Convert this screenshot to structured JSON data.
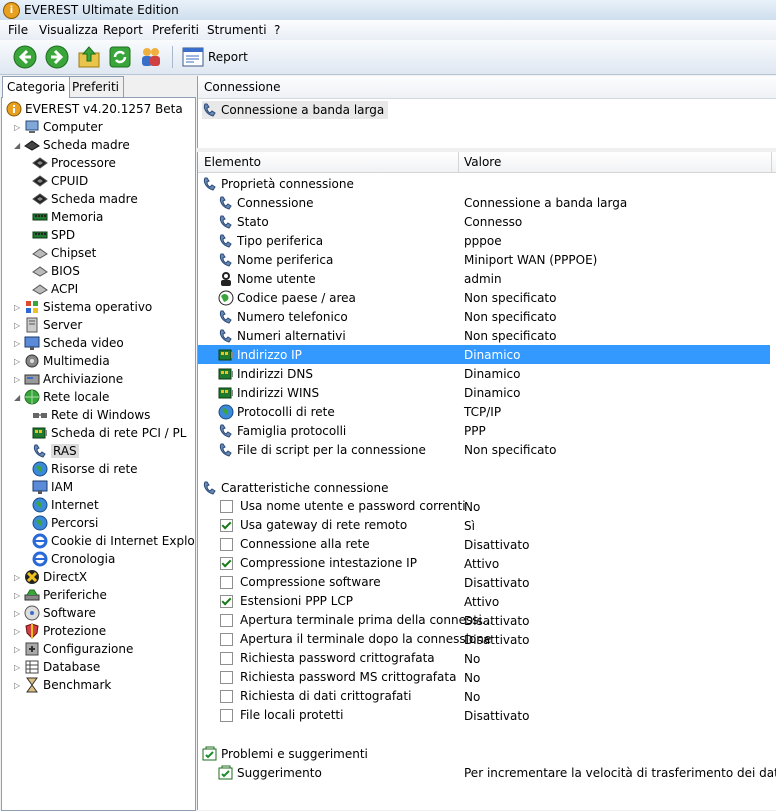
{
  "window": {
    "title": "EVEREST Ultimate Edition"
  },
  "menu": [
    "File",
    "Visualizza",
    "Report",
    "Preferiti",
    "Strumenti",
    "?"
  ],
  "toolbar": {
    "report_label": "Report"
  },
  "tabs": {
    "categoria": "Categoria",
    "preferiti": "Preferiti"
  },
  "tree": [
    {
      "label": "EVEREST v4.20.1257 Beta",
      "icon": "everest-info-icon",
      "level": 0,
      "exp": ""
    },
    {
      "label": "Computer",
      "icon": "computer-icon",
      "level": 1,
      "exp": "▷"
    },
    {
      "label": "Scheda madre",
      "icon": "motherboard-icon",
      "level": 1,
      "exp": "◢"
    },
    {
      "label": "Processore",
      "icon": "chip-icon",
      "level": 2,
      "exp": ""
    },
    {
      "label": "CPUID",
      "icon": "chip-icon",
      "level": 2,
      "exp": ""
    },
    {
      "label": "Scheda madre",
      "icon": "chip-icon",
      "level": 2,
      "exp": ""
    },
    {
      "label": "Memoria",
      "icon": "memory-icon",
      "level": 2,
      "exp": ""
    },
    {
      "label": "SPD",
      "icon": "memory-icon",
      "level": 2,
      "exp": ""
    },
    {
      "label": "Chipset",
      "icon": "chipset-icon",
      "level": 2,
      "exp": ""
    },
    {
      "label": "BIOS",
      "icon": "chipset-icon",
      "level": 2,
      "exp": ""
    },
    {
      "label": "ACPI",
      "icon": "chipset-icon",
      "level": 2,
      "exp": ""
    },
    {
      "label": "Sistema operativo",
      "icon": "windows-icon",
      "level": 1,
      "exp": "▷"
    },
    {
      "label": "Server",
      "icon": "server-icon",
      "level": 1,
      "exp": "▷"
    },
    {
      "label": "Scheda video",
      "icon": "monitor-icon",
      "level": 1,
      "exp": "▷"
    },
    {
      "label": "Multimedia",
      "icon": "multimedia-icon",
      "level": 1,
      "exp": "▷"
    },
    {
      "label": "Archiviazione",
      "icon": "storage-icon",
      "level": 1,
      "exp": "▷"
    },
    {
      "label": "Rete locale",
      "icon": "network-globe-icon",
      "level": 1,
      "exp": "◢"
    },
    {
      "label": "Rete di Windows",
      "icon": "network-icon",
      "level": 2,
      "exp": ""
    },
    {
      "label": "Scheda di rete PCI / PL",
      "icon": "network-card-icon",
      "level": 2,
      "exp": ""
    },
    {
      "label": "RAS",
      "icon": "phone-connection-icon",
      "level": 2,
      "exp": "",
      "selected": true
    },
    {
      "label": "Risorse di rete",
      "icon": "globe-icon",
      "level": 2,
      "exp": ""
    },
    {
      "label": "IAM",
      "icon": "monitor-icon",
      "level": 2,
      "exp": ""
    },
    {
      "label": "Internet",
      "icon": "globe-icon",
      "level": 2,
      "exp": ""
    },
    {
      "label": "Percorsi",
      "icon": "globe-icon",
      "level": 2,
      "exp": ""
    },
    {
      "label": "Cookie di Internet Explo",
      "icon": "ie-icon",
      "level": 2,
      "exp": ""
    },
    {
      "label": "Cronologia",
      "icon": "ie-icon",
      "level": 2,
      "exp": ""
    },
    {
      "label": "DirectX",
      "icon": "directx-icon",
      "level": 1,
      "exp": "▷"
    },
    {
      "label": "Periferiche",
      "icon": "devices-icon",
      "level": 1,
      "exp": "▷"
    },
    {
      "label": "Software",
      "icon": "software-icon",
      "level": 1,
      "exp": "▷"
    },
    {
      "label": "Protezione",
      "icon": "shield-icon",
      "level": 1,
      "exp": "▷"
    },
    {
      "label": "Configurazione",
      "icon": "config-icon",
      "level": 1,
      "exp": "▷"
    },
    {
      "label": "Database",
      "icon": "database-icon",
      "level": 1,
      "exp": "▷"
    },
    {
      "label": "Benchmark",
      "icon": "hourglass-icon",
      "level": 1,
      "exp": "▷"
    }
  ],
  "right_top": {
    "header": "Connessione",
    "item": "Connessione a banda larga"
  },
  "list": {
    "col_element": "Elemento",
    "col_value": "Valore",
    "rows": [
      {
        "type": "group",
        "label": "Proprietà connessione",
        "icon": "phone-connection-icon"
      },
      {
        "type": "item",
        "label": "Connessione",
        "value": "Connessione a banda larga",
        "icon": "phone-connection-icon"
      },
      {
        "type": "item",
        "label": "Stato",
        "value": "Connesso",
        "icon": "phone-connection-icon"
      },
      {
        "type": "item",
        "label": "Tipo periferica",
        "value": "pppoe",
        "icon": "phone-connection-icon"
      },
      {
        "type": "item",
        "label": "Nome periferica",
        "value": "Miniport WAN (PPPOE)",
        "icon": "phone-connection-icon"
      },
      {
        "type": "item",
        "label": "Nome utente",
        "value": "admin",
        "icon": "user-icon"
      },
      {
        "type": "item",
        "label": "Codice paese / area",
        "value": "Non specificato",
        "icon": "country-globe-icon"
      },
      {
        "type": "item",
        "label": "Numero telefonico",
        "value": "Non specificato",
        "icon": "phone-connection-icon"
      },
      {
        "type": "item",
        "label": "Numeri alternativi",
        "value": "Non specificato",
        "icon": "phone-connection-icon"
      },
      {
        "type": "item",
        "label": "Indirizzo IP",
        "value": "Dinamico",
        "icon": "network-card-icon",
        "selected": true
      },
      {
        "type": "item",
        "label": "Indirizzi DNS",
        "value": "Dinamico",
        "icon": "network-card-icon"
      },
      {
        "type": "item",
        "label": "Indirizzi WINS",
        "value": "Dinamico",
        "icon": "network-card-icon"
      },
      {
        "type": "item",
        "label": "Protocolli di rete",
        "value": "TCP/IP",
        "icon": "globe-icon"
      },
      {
        "type": "item",
        "label": "Famiglia protocolli",
        "value": "PPP",
        "icon": "phone-connection-icon"
      },
      {
        "type": "item",
        "label": "File di script per la connessione",
        "value": "Non specificato",
        "icon": "phone-connection-icon"
      },
      {
        "type": "blank"
      },
      {
        "type": "group",
        "label": "Caratteristiche connessione",
        "icon": "phone-connection-icon"
      },
      {
        "type": "check",
        "label": "Usa nome utente e password correnti",
        "value": "No",
        "checked": false
      },
      {
        "type": "check",
        "label": "Usa gateway di rete remoto",
        "value": "Sì",
        "checked": true
      },
      {
        "type": "check",
        "label": "Connessione alla rete",
        "value": "Disattivato",
        "checked": false
      },
      {
        "type": "check",
        "label": "Compressione intestazione IP",
        "value": "Attivo",
        "checked": true
      },
      {
        "type": "check",
        "label": "Compressione software",
        "value": "Disattivato",
        "checked": false
      },
      {
        "type": "check",
        "label": "Estensioni PPP LCP",
        "value": "Attivo",
        "checked": true
      },
      {
        "type": "check",
        "label": "Apertura terminale prima della connessi...",
        "value": "Disattivato",
        "checked": false
      },
      {
        "type": "check",
        "label": "Apertura il terminale dopo la connessione",
        "value": "Disattivato",
        "checked": false
      },
      {
        "type": "check",
        "label": "Richiesta password crittografata",
        "value": "No",
        "checked": false
      },
      {
        "type": "check",
        "label": "Richiesta password MS crittografata",
        "value": "No",
        "checked": false
      },
      {
        "type": "check",
        "label": "Richiesta di dati crittografati",
        "value": "No",
        "checked": false
      },
      {
        "type": "check",
        "label": "File locali protetti",
        "value": "Disattivato",
        "checked": false
      },
      {
        "type": "blank"
      },
      {
        "type": "group",
        "label": "Problemi e suggerimenti",
        "icon": "hint-icon"
      },
      {
        "type": "item",
        "label": "Suggerimento",
        "value": "Per incrementare la velocità di trasferimento dei dati in ...",
        "icon": "hint-icon"
      }
    ]
  },
  "colors": {
    "selection": "#3399ff",
    "tree_selection": "#dcdcdc",
    "border": "#8e9fb4"
  }
}
